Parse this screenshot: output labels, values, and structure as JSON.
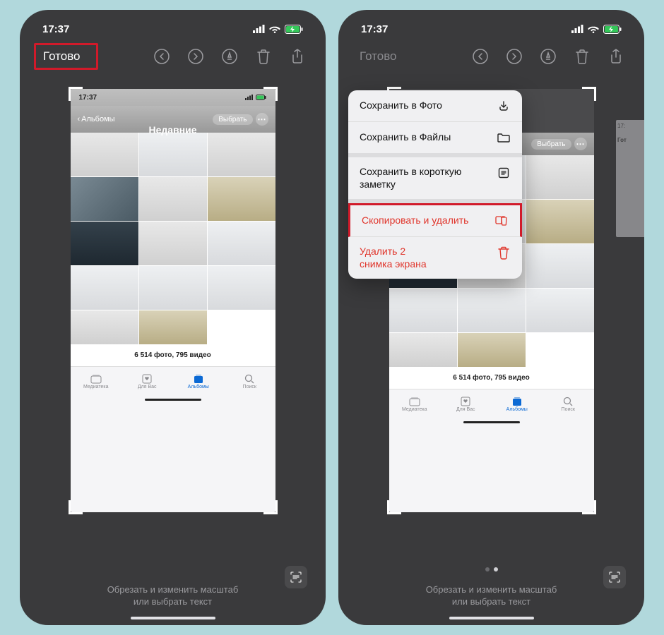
{
  "status": {
    "time": "17:37"
  },
  "toolbar": {
    "done": "Готово"
  },
  "screenshot": {
    "inner_time": "17:37",
    "back": "Альбомы",
    "title": "Недавние",
    "select": "Выбрать",
    "count": "6 514 фото, 795 видео",
    "tabs": {
      "library": "Медиатека",
      "for_you": "Для Вас",
      "albums": "Альбомы",
      "search": "Поиск"
    }
  },
  "pager": {
    "count": 2
  },
  "footer": {
    "hint_l1": "Обрезать и изменить масштаб",
    "hint_l2": "или выбрать текст"
  },
  "menu": {
    "save_photo": "Сохранить в Фото",
    "save_files": "Сохранить в Файлы",
    "save_note": "Сохранить в короткую заметку",
    "copy_delete": "Скопировать и удалить",
    "delete_n_l1": "Удалить 2",
    "delete_n_l2": "снимка экрана"
  },
  "peek": {
    "time": "17:",
    "done": "Гот"
  },
  "icons": {
    "undo": "undo-icon",
    "redo": "redo-icon",
    "markup": "markup-icon",
    "trash": "trash-icon",
    "share": "share-icon",
    "scan": "scan-text-icon"
  }
}
